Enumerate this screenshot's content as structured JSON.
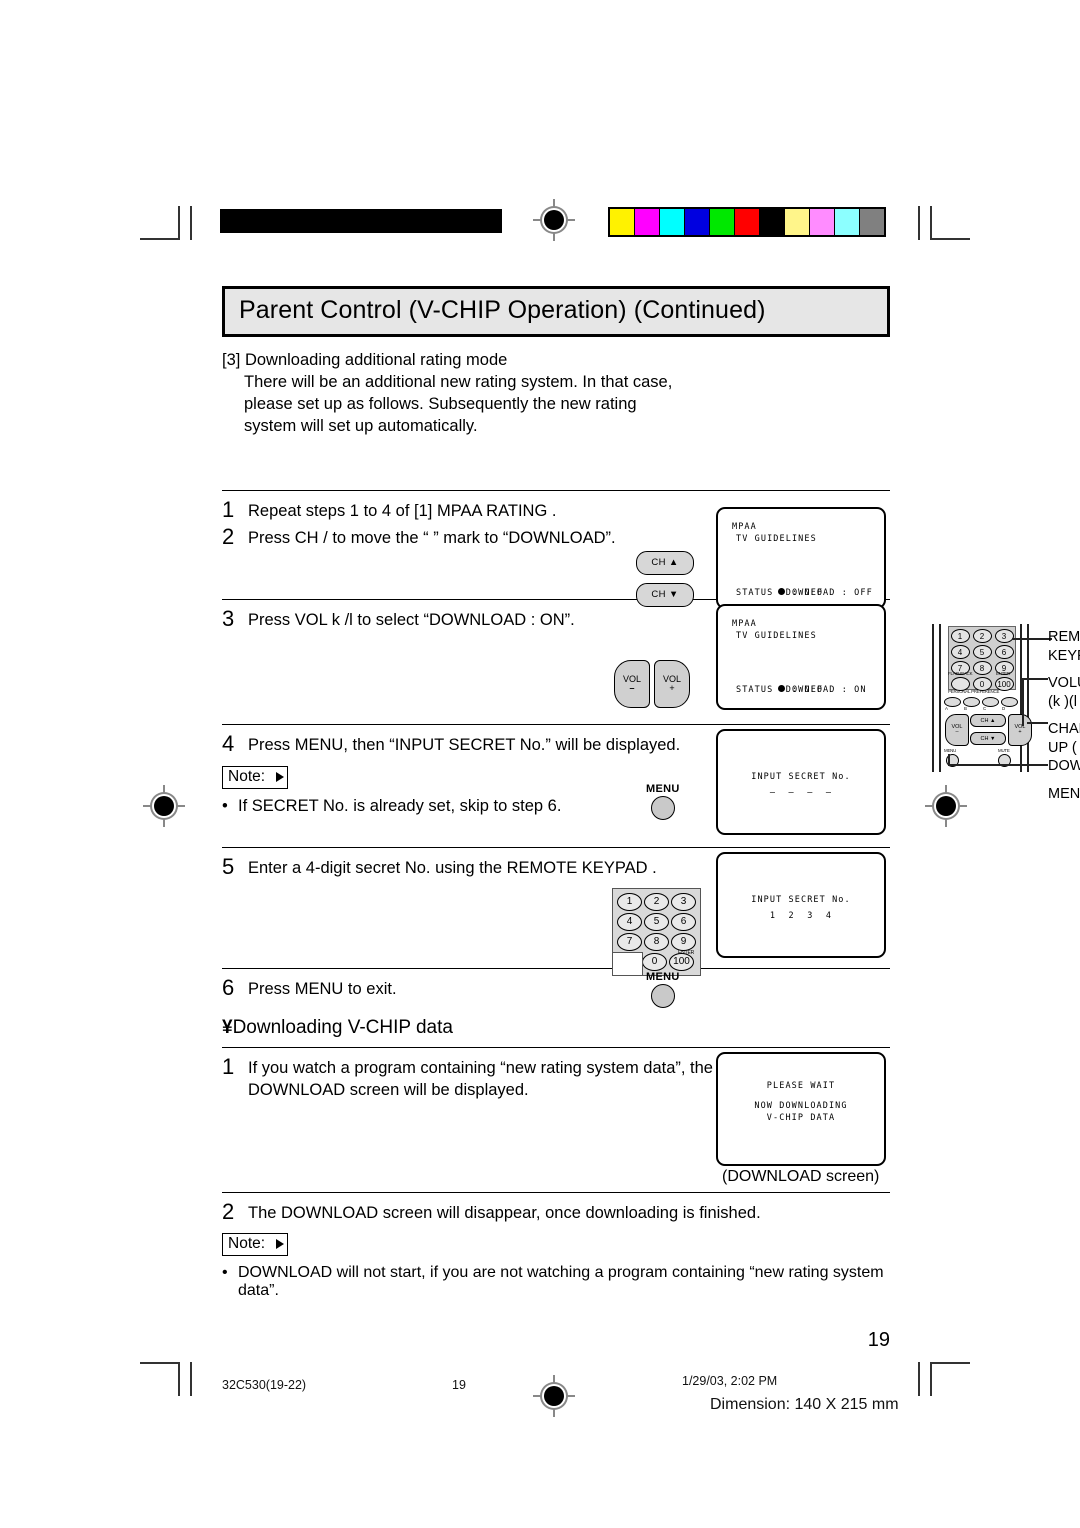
{
  "header": {
    "title": "Parent Control (V-CHIP Operation) (Continued)",
    "color_bar": [
      "#FFF200",
      "#FF00FF",
      "#00FFFF",
      "#0000E0",
      "#00E800",
      "#FF0000",
      "#000000",
      "#FFF58A",
      "#FF8CFF",
      "#8CFFFF",
      "#808080"
    ]
  },
  "intro": {
    "marker": "[3]",
    "heading": "Downloading additional rating mode",
    "line1": "There will be an additional new rating system. In that case,",
    "line2": "please set up as follows. Subsequently the new rating",
    "line3": "system will set up automatically."
  },
  "remote_diagram": {
    "keys": [
      "1",
      "2",
      "3",
      "4",
      "5",
      "6",
      "7",
      "8",
      "9",
      "0",
      "100"
    ],
    "flashback_label": "FLASHBACK",
    "enter_label": "ENTER",
    "personal_preference_label": "PERSONAL PREFERENCE",
    "pp_keys": [
      "A",
      "B",
      "C",
      "D"
    ],
    "vol_minus": "VOL\n–",
    "vol_plus": "VOL\n+",
    "ch_up": "CH ▲",
    "ch_down": "CH ▼",
    "menu_label": "MENU",
    "mute_label": "MUTE",
    "labels": [
      "REMOTE",
      "KEYPAD",
      "VOLUME",
      "(k )(l  )",
      "CHANNEL",
      "UP (  )/",
      "DOWN (   )",
      "MENU"
    ]
  },
  "steps": [
    {
      "num": "1",
      "text": "Repeat steps 1 to 4 of [1] MPAA RATING .",
      "buttons": [],
      "screen": null
    },
    {
      "num": "2",
      "text": "Press CH    /     to move the “   ” mark to “DOWNLOAD”.",
      "buttons": [
        "CH ▲",
        "CH ▼"
      ],
      "screen": {
        "line1": "MPAA",
        "line2": "TV GUIDELINES",
        "line3": "DOWNLOAD : OFF",
        "line4": "STATUS   : OFF"
      }
    },
    {
      "num": "3",
      "text": "Press VOL k /l    to select “DOWNLOAD : ON”.",
      "buttons": [
        "VOL –",
        "VOL +"
      ],
      "screen": {
        "line1": "MPAA",
        "line2": "TV GUIDELINES",
        "line3": "DOWNLOAD : ON",
        "line4": "STATUS   : OFF"
      }
    },
    {
      "num": "4",
      "text": "Press MENU, then “INPUT SECRET No.” will be displayed.",
      "note_label": "Note:",
      "note_bullet": "If SECRET No. is already set, skip to step 6.",
      "buttons": [
        "MENU"
      ],
      "screen": {
        "line1": "INPUT SECRET No.",
        "line2": "–  –  –  –"
      }
    },
    {
      "num": "5",
      "text": "Enter a 4-digit secret No. using the REMOTE KEYPAD .",
      "buttons": [
        "keypad"
      ],
      "screen": {
        "line1": "INPUT SECRET No.",
        "line2": "1  2  3  4"
      }
    },
    {
      "num": "6",
      "text": "Press MENU to exit.",
      "buttons": [
        "MENU"
      ],
      "screen": null
    }
  ],
  "subsection": {
    "bullet": "¥",
    "heading": "Downloading V-CHIP data",
    "steps": [
      {
        "num": "1",
        "line1": "If you watch a program containing “new rating system data”, the",
        "line2": "DOWNLOAD screen will be displayed.",
        "screen": {
          "line1": "PLEASE WAIT",
          "line2": "NOW DOWNLOADING",
          "line3": "V-CHIP DATA"
        },
        "caption": "(DOWNLOAD screen)"
      },
      {
        "num": "2",
        "text": "The DOWNLOAD screen will disappear, once downloading is finished.",
        "note_label": "Note:",
        "note_bullet": "DOWNLOAD will not start, if you are not watching a program containing “new rating system data”."
      }
    ]
  },
  "page_number": "19",
  "footer": {
    "doc_id": "32C530(19-22)",
    "page": "19",
    "timestamp": "1/29/03, 2:02 PM",
    "dimension": "Dimension: 140  X 215 mm"
  }
}
